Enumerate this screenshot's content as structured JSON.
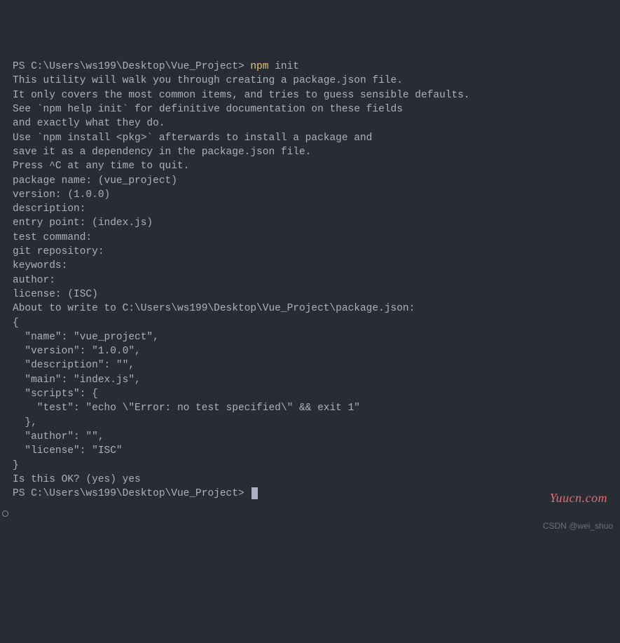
{
  "terminal": {
    "prompt1_prefix": "PS C:\\Users\\ws199\\Desktop\\Vue_Project> ",
    "command_npm": "npm",
    "command_arg": " init",
    "intro_line1": "This utility will walk you through creating a package.json file.",
    "intro_line2": "It only covers the most common items, and tries to guess sensible defaults.",
    "blank1": "",
    "help_line1": "See `npm help init` for definitive documentation on these fields",
    "help_line2": "and exactly what they do.",
    "blank2": "",
    "install_line1": "Use `npm install <pkg>` afterwards to install a package and",
    "install_line2": "save it as a dependency in the package.json file.",
    "blank3": "",
    "quit_line": "Press ^C at any time to quit.",
    "pkg_name": "package name: (vue_project)",
    "version": "version: (1.0.0)",
    "description": "description:",
    "entry_point": "entry point: (index.js)",
    "test_command": "test command:",
    "git_repo": "git repository:",
    "keywords": "keywords:",
    "author": "author:",
    "license": "license: (ISC)",
    "about_write": "About to write to C:\\Users\\ws199\\Desktop\\Vue_Project\\package.json:",
    "blank4": "",
    "json_open": "{",
    "json_name": "  \"name\": \"vue_project\",",
    "json_version": "  \"version\": \"1.0.0\",",
    "json_desc": "  \"description\": \"\",",
    "json_main": "  \"main\": \"index.js\",",
    "json_scripts_open": "  \"scripts\": {",
    "json_test": "    \"test\": \"echo \\\"Error: no test specified\\\" && exit 1\"",
    "json_scripts_close": "  },",
    "json_author": "  \"author\": \"\",",
    "json_license": "  \"license\": \"ISC\"",
    "json_close": "}",
    "blank5": "",
    "blank6": "",
    "is_ok": "Is this OK? (yes) yes",
    "prompt2_prefix": "PS C:\\Users\\ws199\\Desktop\\Vue_Project> "
  },
  "watermarks": {
    "yuucn": "Yuucn.com",
    "csdn": "CSDN @wei_shuo"
  }
}
